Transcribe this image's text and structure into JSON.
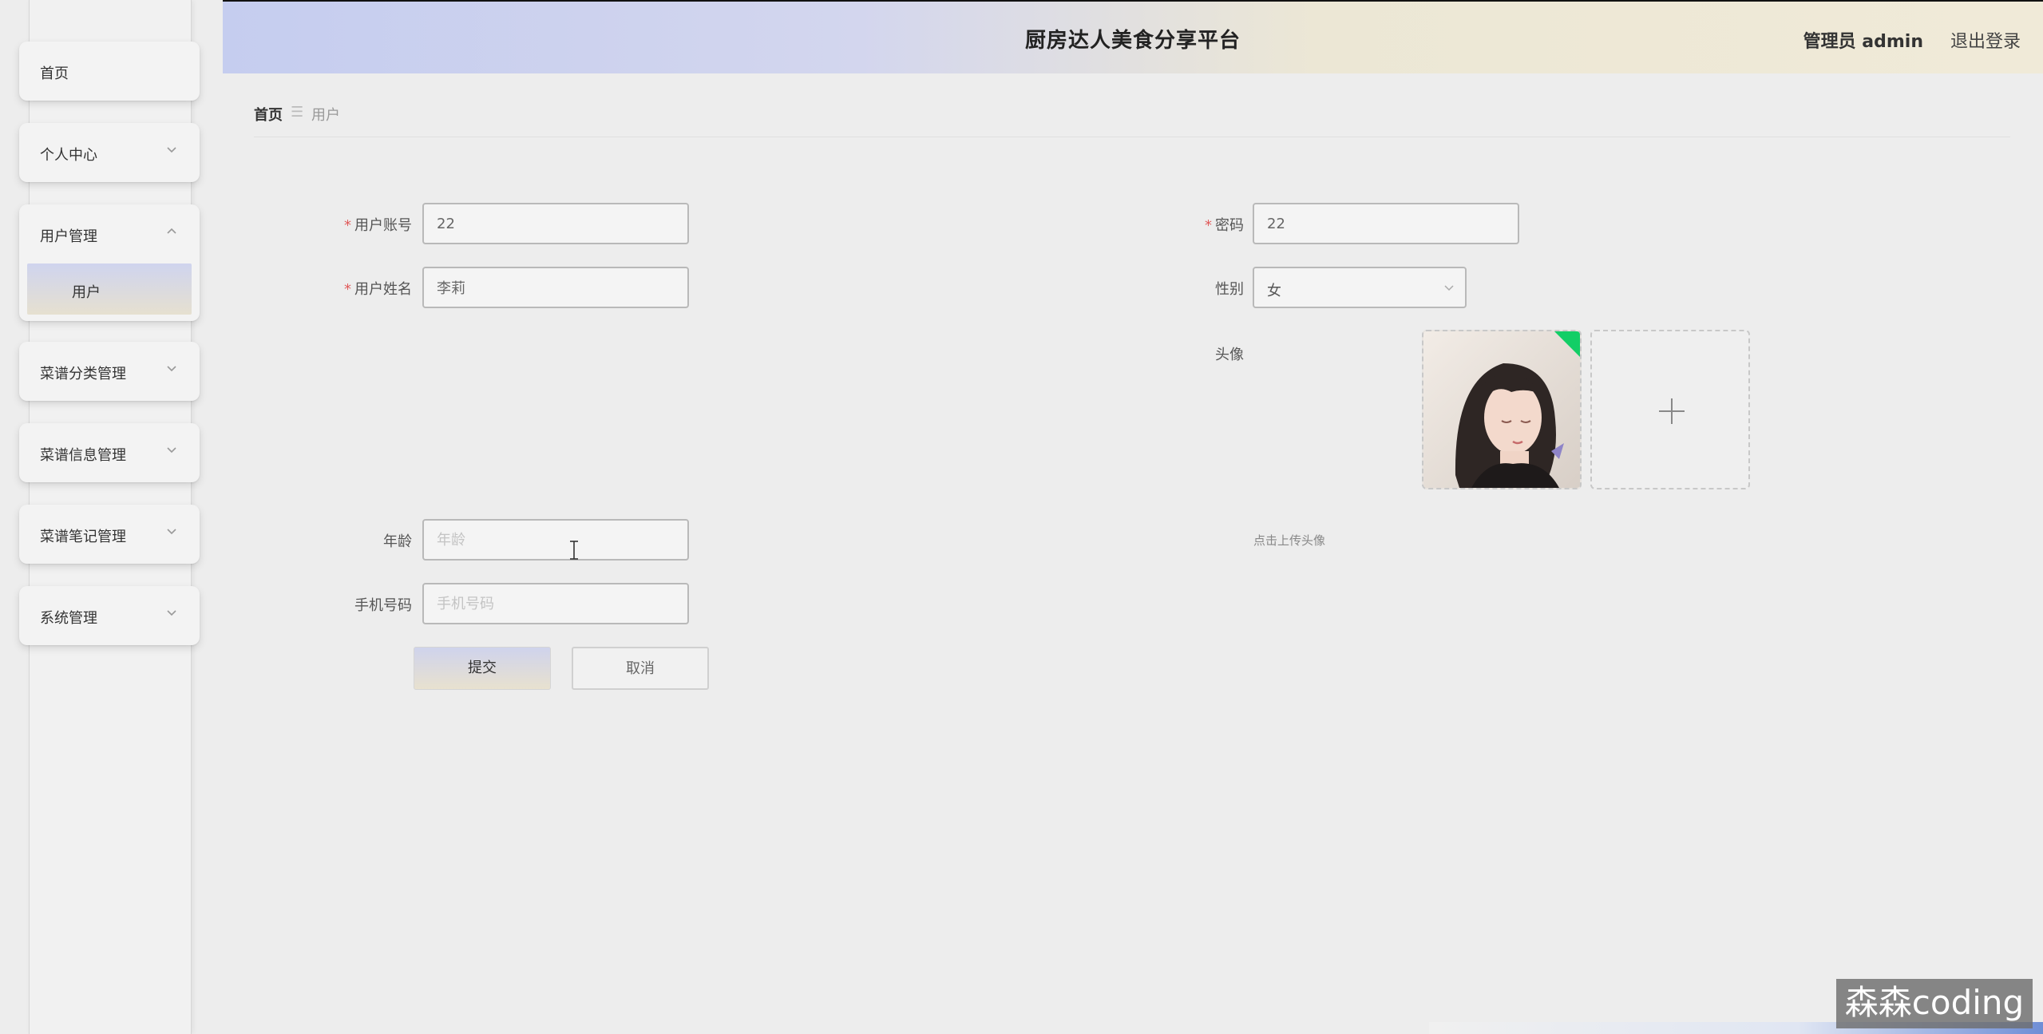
{
  "header": {
    "title": "厨房达人美食分享平台",
    "user": "管理员 admin",
    "logout": "退出登录"
  },
  "sidebar": {
    "items": [
      {
        "label": "首页"
      },
      {
        "label": "个人中心"
      },
      {
        "label": "用户管理",
        "expanded": true,
        "children": [
          {
            "label": "用户"
          }
        ]
      },
      {
        "label": "菜谱分类管理"
      },
      {
        "label": "菜谱信息管理"
      },
      {
        "label": "菜谱笔记管理"
      },
      {
        "label": "系统管理"
      }
    ]
  },
  "breadcrumb": {
    "home": "首页",
    "separator": "☰",
    "current": "用户"
  },
  "form": {
    "account": {
      "label": "用户账号",
      "value": "22"
    },
    "password": {
      "label": "密码",
      "value": "22"
    },
    "name": {
      "label": "用户姓名",
      "value": "李莉"
    },
    "gender": {
      "label": "性别",
      "value": "女"
    },
    "avatar": {
      "label": "头像",
      "tip": "点击上传头像"
    },
    "age": {
      "label": "年龄",
      "value": "",
      "placeholder": "年龄"
    },
    "phone": {
      "label": "手机号码",
      "value": "",
      "placeholder": "手机号码"
    },
    "required_mark": "*"
  },
  "buttons": {
    "submit": "提交",
    "cancel": "取消"
  },
  "watermark": "森森coding",
  "colors": {
    "required": "#e05a5a",
    "upload_success": "#13ce66",
    "header_gradient_start": "#c5cdef",
    "header_gradient_end": "#f0ead8"
  },
  "icons": {
    "menu_chevron": "chevron-down-icon",
    "expanded_chevron": "chevron-up-icon",
    "select_chevron": "chevron-down-icon",
    "upload": "plus-icon"
  }
}
